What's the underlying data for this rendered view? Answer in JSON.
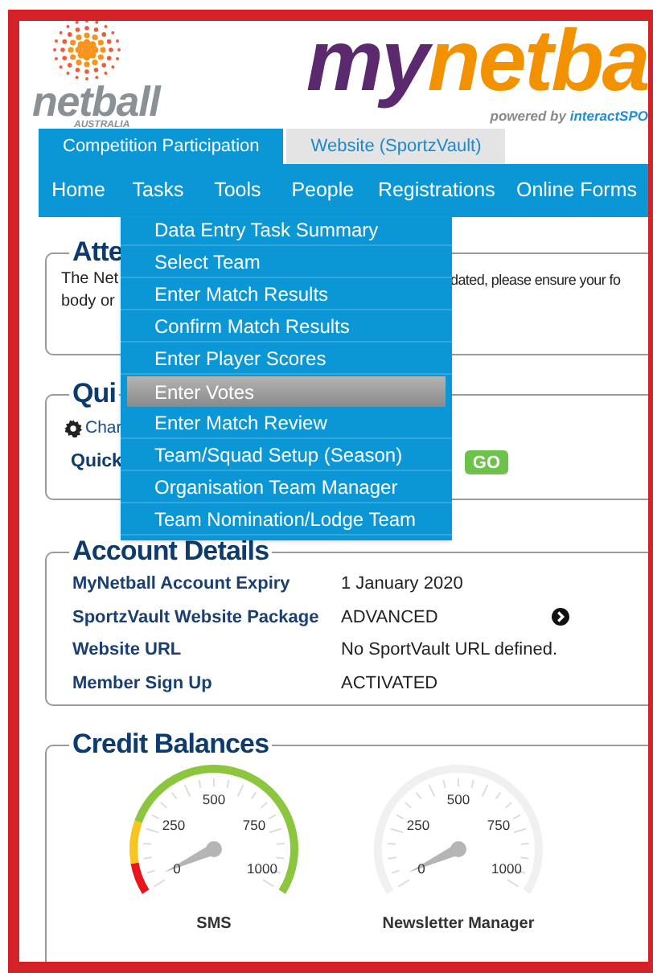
{
  "brand": {
    "org_name": "netball",
    "org_sub": "AUSTRALIA",
    "title_a": "my",
    "title_b": "netba",
    "powered_a": "powered by ",
    "powered_b": "interactSPO"
  },
  "tabs": [
    {
      "label": "Competition Participation",
      "selected": true
    },
    {
      "label": "Website (SportzVault)",
      "selected": false
    }
  ],
  "nav": [
    {
      "label": "Home"
    },
    {
      "label": "Tasks"
    },
    {
      "label": "Tools"
    },
    {
      "label": "People"
    },
    {
      "label": "Registrations"
    },
    {
      "label": "Online Forms"
    }
  ],
  "menu": [
    {
      "label": "Data Entry Task Summary",
      "selected": false
    },
    {
      "label": "Select Team",
      "selected": false
    },
    {
      "label": "Enter Match Results",
      "selected": false
    },
    {
      "label": "Confirm Match Results",
      "selected": false
    },
    {
      "label": "Enter Player Scores",
      "selected": false
    },
    {
      "label": "Enter Votes",
      "selected": true
    },
    {
      "label": "Enter Match Review",
      "selected": false
    },
    {
      "label": "Team/Squad Setup (Season)",
      "selected": false
    },
    {
      "label": "Organisation Team Manager",
      "selected": false
    },
    {
      "label": "Team Nomination/Lodge Team",
      "selected": false
    }
  ],
  "attention": {
    "heading": "Atte",
    "line1_left": "The Net",
    "line1_right": "dated, please ensure your fo",
    "line2_left": "body or"
  },
  "quick": {
    "heading": "Qui",
    "link": "Char",
    "label": "Quick",
    "button": "GO"
  },
  "account": {
    "heading": "Account Details",
    "rows": [
      {
        "label": "MyNetball Account Expiry",
        "value": "1 January 2020",
        "has_link": false
      },
      {
        "label": "SportzVault Website Package",
        "value": "ADVANCED",
        "has_link": true
      },
      {
        "label": "Website URL",
        "value": "No SportVault URL defined.",
        "has_link": false
      },
      {
        "label": "Member Sign Up",
        "value": "ACTIVATED",
        "has_link": false
      }
    ]
  },
  "credits": {
    "heading": "Credit Balances",
    "gauges": [
      {
        "kind": "colored",
        "label": "SMS",
        "scale": [
          "0",
          "250",
          "500",
          "750",
          "1000"
        ]
      },
      {
        "kind": "empty",
        "label": "Newsletter Manager",
        "scale": [
          "0",
          "250",
          "500",
          "750",
          "1000"
        ]
      }
    ]
  }
}
